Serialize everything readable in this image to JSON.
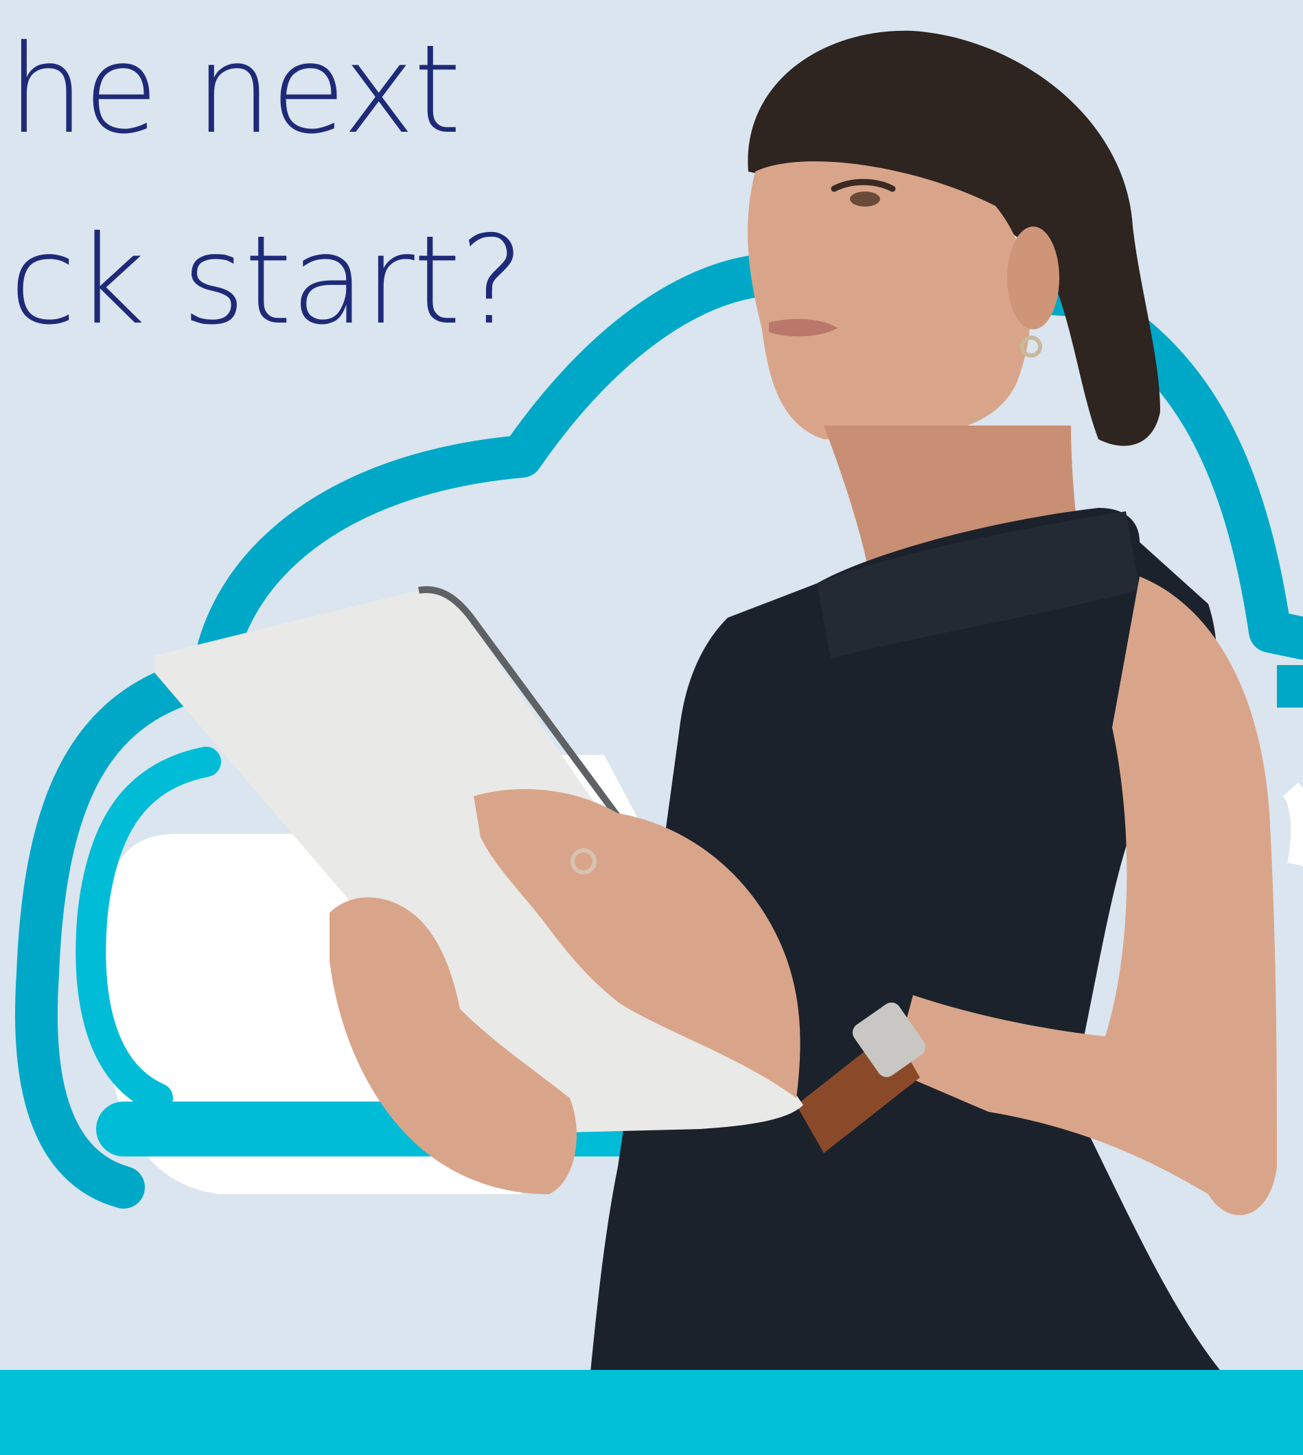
{
  "headline": {
    "line1": "he next",
    "line2": "ck start?"
  },
  "colors": {
    "background": "#dae5ef",
    "headline": "#1e2a78",
    "cloud_outline": "#00a8c8",
    "cloud_inner": "#00bcd6",
    "band": "#00c0d8",
    "dress": "#1c222b",
    "skin": "#d9a58a",
    "tablet": "#e9e9e7",
    "hair": "#2e2420",
    "watch_strap": "#8a4a2a"
  },
  "icons": {
    "cloud": "cloud-icon"
  }
}
